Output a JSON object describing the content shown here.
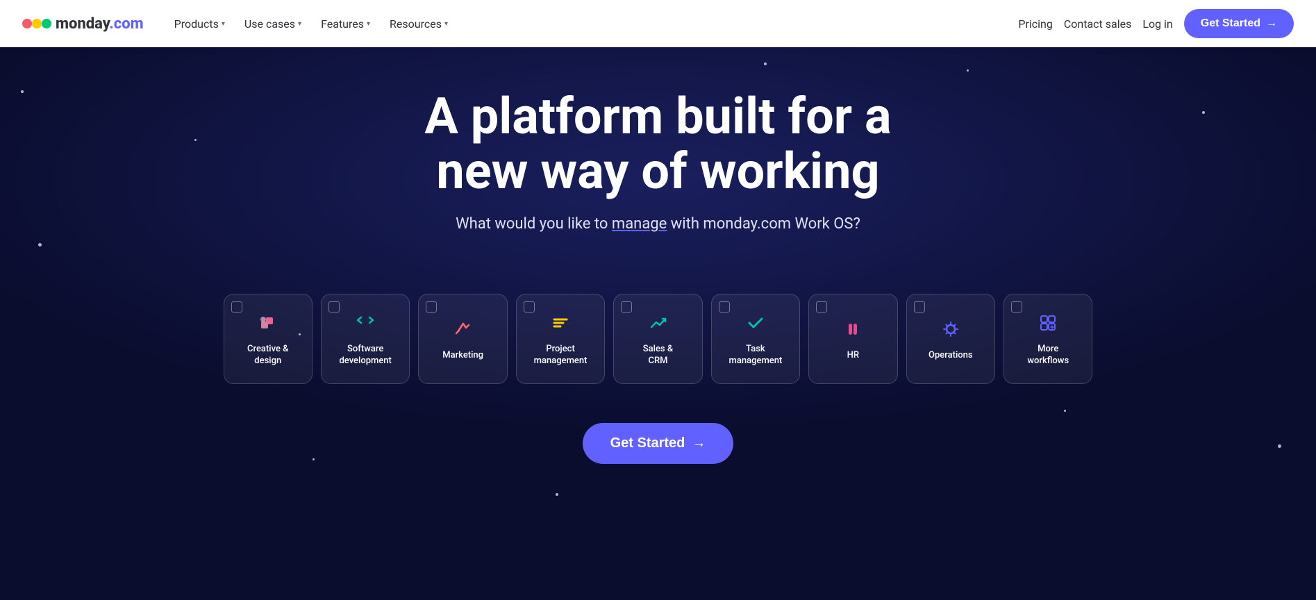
{
  "nav": {
    "logo_text": "monday",
    "logo_suffix": ".com",
    "links": [
      {
        "label": "Products",
        "has_chevron": true
      },
      {
        "label": "Use cases",
        "has_chevron": true
      },
      {
        "label": "Features",
        "has_chevron": true
      },
      {
        "label": "Resources",
        "has_chevron": true
      }
    ],
    "right_links": [
      {
        "label": "Pricing"
      },
      {
        "label": "Contact sales"
      },
      {
        "label": "Log in"
      }
    ],
    "cta_label": "Get Started",
    "cta_arrow": "→"
  },
  "hero": {
    "title_line1": "A platform built for a",
    "title_line2": "new way of working",
    "subtitle": "What would you like to manage with monday.com Work OS?",
    "cta_label": "Get Started",
    "cta_arrow": "→"
  },
  "workflow_cards": [
    {
      "id": "creative",
      "label": "Creative &\ndesign",
      "icon_name": "creative-design-icon"
    },
    {
      "id": "software",
      "label": "Software\ndevelopment",
      "icon_name": "software-dev-icon"
    },
    {
      "id": "marketing",
      "label": "Marketing",
      "icon_name": "marketing-icon"
    },
    {
      "id": "project",
      "label": "Project\nmanagement",
      "icon_name": "project-mgmt-icon"
    },
    {
      "id": "sales",
      "label": "Sales &\nCRM",
      "icon_name": "sales-crm-icon"
    },
    {
      "id": "task",
      "label": "Task\nmanagement",
      "icon_name": "task-mgmt-icon"
    },
    {
      "id": "hr",
      "label": "HR",
      "icon_name": "hr-icon"
    },
    {
      "id": "operations",
      "label": "Operations",
      "icon_name": "operations-icon"
    },
    {
      "id": "more",
      "label": "More\nworkflows",
      "icon_name": "more-workflows-icon"
    }
  ]
}
